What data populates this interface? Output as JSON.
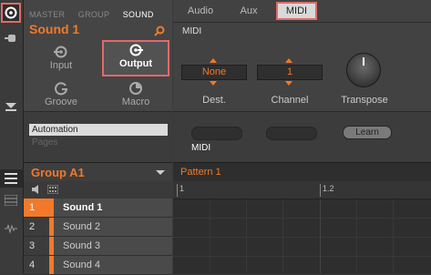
{
  "sound_panel": {
    "tabs": [
      "MASTER",
      "GROUP",
      "SOUND"
    ],
    "title": "Sound 1",
    "buttons": [
      {
        "label": "Input",
        "icon": "input-icon"
      },
      {
        "label": "Output",
        "icon": "output-icon"
      },
      {
        "label": "Groove",
        "icon": "groove-icon"
      },
      {
        "label": "Macro",
        "icon": "macro-icon"
      }
    ]
  },
  "midi_panel": {
    "tabs": [
      "Audio",
      "Aux",
      "MIDI"
    ],
    "section_title": "MIDI",
    "dest_value": "None",
    "channel_value": "1",
    "labels": {
      "dest": "Dest.",
      "channel": "Channel",
      "transpose": "Transpose"
    }
  },
  "lower": {
    "list": [
      "Automation",
      "Pages"
    ],
    "learn_label": "Learn",
    "midi_label": "MIDI"
  },
  "group": {
    "title": "Group A1",
    "sounds": [
      {
        "num": "1",
        "name": "Sound 1"
      },
      {
        "num": "2",
        "name": "Sound 2"
      },
      {
        "num": "3",
        "name": "Sound 3"
      },
      {
        "num": "4",
        "name": "Sound 4"
      }
    ]
  },
  "pattern": {
    "title": "Pattern 1",
    "ruler": [
      "1",
      "1.2"
    ]
  },
  "colors": {
    "accent": "#f07a2a",
    "highlight": "#e06a6a"
  }
}
